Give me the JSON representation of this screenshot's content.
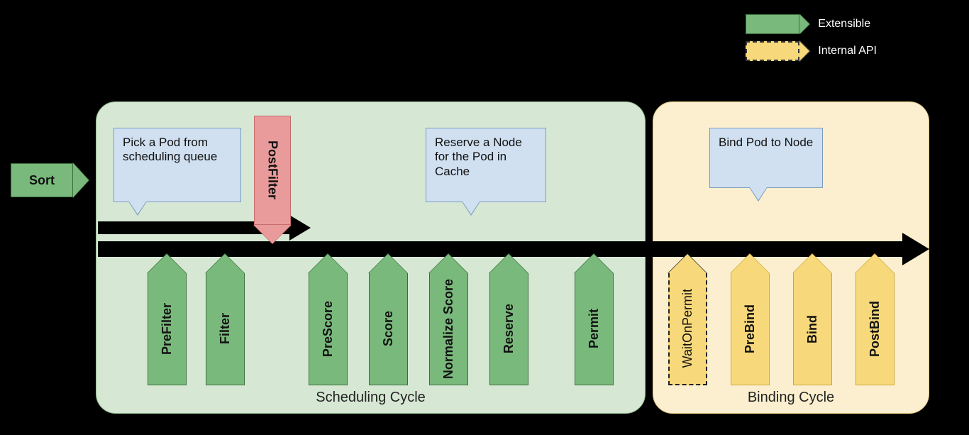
{
  "legend": {
    "extensible": "Extensible",
    "internal": "Internal API"
  },
  "sort_label": "Sort",
  "postfilter_label": "PostFilter",
  "scheduling_cycle": {
    "title": "Scheduling Cycle",
    "callout_pick": "Pick a Pod from scheduling queue",
    "callout_reserve": "Reserve a Node for the Pod in Cache",
    "stages": {
      "prefilter": "PreFilter",
      "filter": "Filter",
      "prescore": "PreScore",
      "score": "Score",
      "normalize": "Normalize Score",
      "reserve": "Reserve",
      "permit": "Permit"
    }
  },
  "binding_cycle": {
    "title": "Binding Cycle",
    "callout_bind": "Bind Pod to Node",
    "stages": {
      "waitonpermit": "WaitOnPermit",
      "prebind": "PreBind",
      "bind": "Bind",
      "postbind": "PostBind"
    }
  }
}
